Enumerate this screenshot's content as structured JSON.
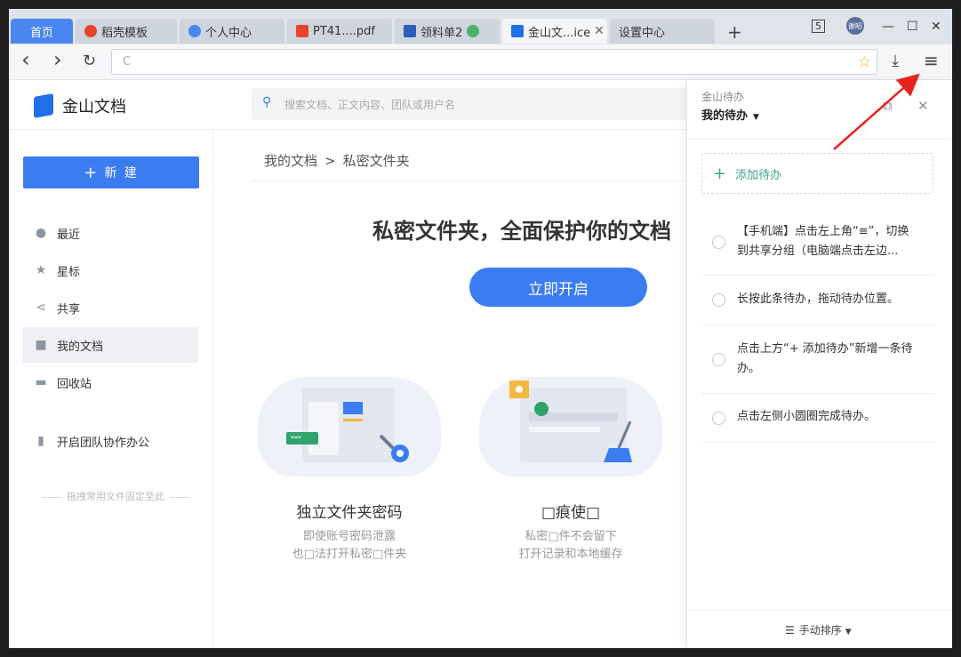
{
  "tabs": [
    {
      "label": "首页"
    },
    {
      "label": "稻壳模板"
    },
    {
      "label": "个人中心"
    },
    {
      "label": "PT41....pdf"
    },
    {
      "label": "领料单2"
    },
    {
      "label": "金山文...ice"
    },
    {
      "label": "设置中心"
    }
  ],
  "new_tab": "+",
  "window": {
    "badge": "5",
    "user": "谢昭",
    "minimize": "—",
    "maximize": "☐",
    "close": "✕"
  },
  "toolbar": {
    "back": "‹",
    "forward": "›",
    "reload": "↻",
    "url": "C",
    "star": "☆",
    "download": "⤓",
    "menu": "≡"
  },
  "app": {
    "logo": "金山文档",
    "search_placeholder": "搜索文档、正文内容、团队或用户名",
    "new_button": "新 建",
    "nav": [
      {
        "label": "最近",
        "icon": "clock-icon"
      },
      {
        "label": "星标",
        "icon": "star-icon"
      },
      {
        "label": "共享",
        "icon": "share-icon"
      },
      {
        "label": "我的文档",
        "icon": "folder-icon"
      },
      {
        "label": "回收站",
        "icon": "trash-icon"
      },
      {
        "label": "开启团队协作办公",
        "icon": "building-icon"
      }
    ],
    "pin_hint": "拖拽常用文件固定至此",
    "breadcrumb": {
      "root": "我的文档",
      "sep": ">",
      "current": "私密文件夹"
    },
    "headline": "私密文件夹，全面保护你的文档",
    "open_button": "立即开启",
    "features": [
      {
        "title": "独立文件夹密码",
        "desc1": "即使账号密码泄露",
        "desc2": "也□法打开私密□件夹"
      },
      {
        "title": "□痕使□",
        "desc1": "私密□件不会留下",
        "desc2": "打开记录和本地缓存"
      }
    ]
  },
  "todo": {
    "subtitle": "金山待办",
    "title": "我的待办",
    "add_label": "添加待办",
    "items": [
      {
        "line1": "【手机端】点击左上角“≡”，切换",
        "line2": "到共享分组（电脑端点击左边..."
      },
      {
        "line1": "长按此条待办，拖动待办位置。",
        "line2": ""
      },
      {
        "line1": "点击上方“+ 添加待办”新增一条待",
        "line2": "办。"
      },
      {
        "line1": "点击左侧小圆圈完成待办。",
        "line2": ""
      }
    ],
    "sort_label": "手动排序"
  },
  "colors": {
    "accent": "#3b7df0",
    "arrow": "#e8231f",
    "todo_green": "#3aa28a"
  }
}
